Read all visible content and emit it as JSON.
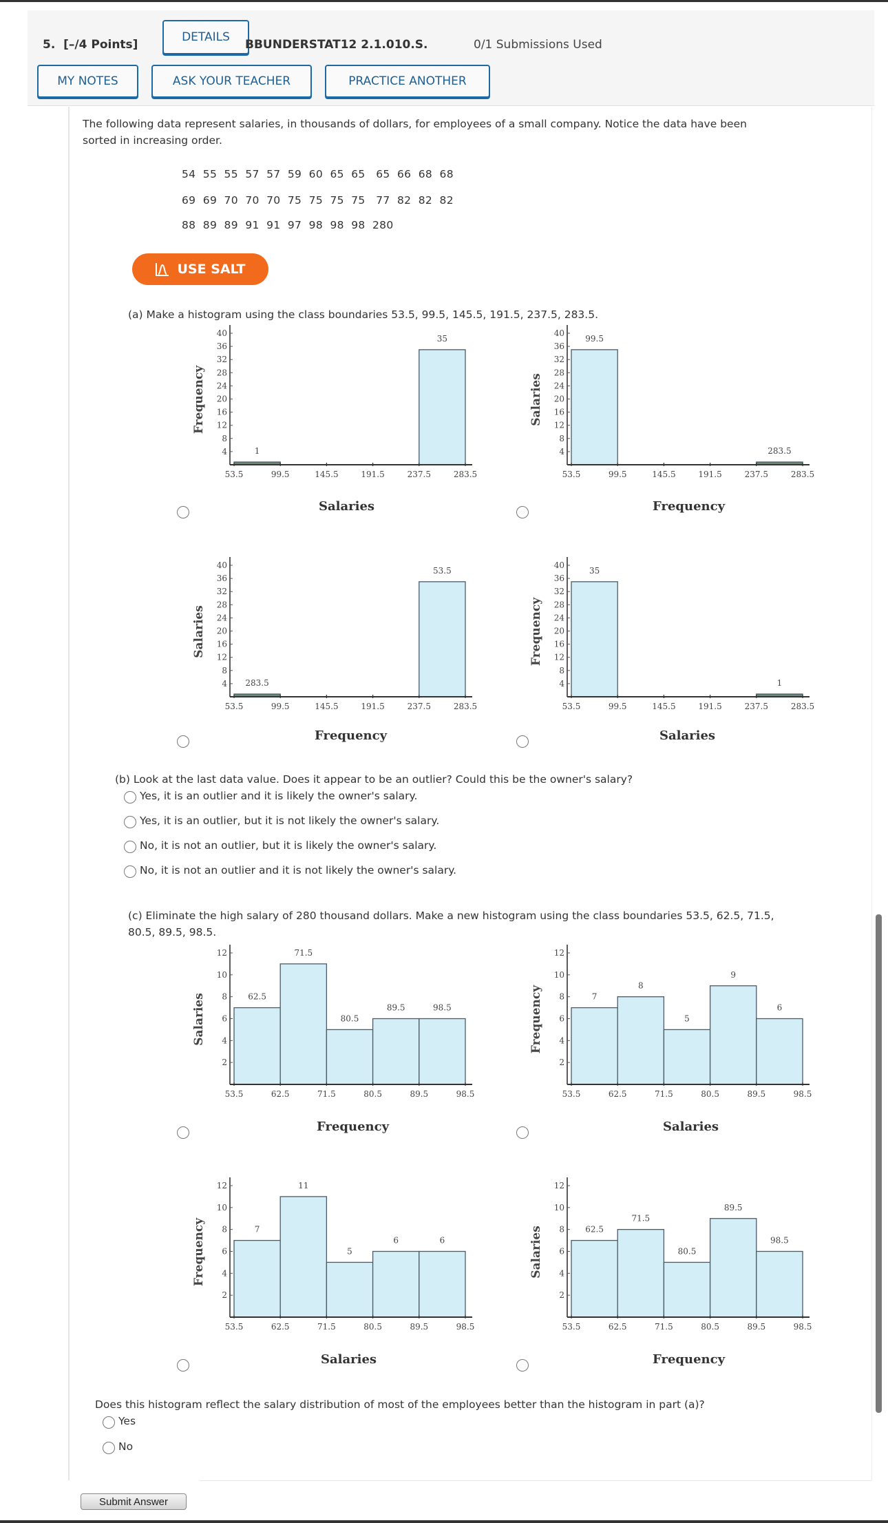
{
  "header": {
    "question_number": "5.",
    "points": "[–/4 Points]",
    "details_label": "DETAILS",
    "question_code": "BBUNDERSTAT12 2.1.010.S.",
    "submissions": "0/1 Submissions Used",
    "my_notes_label": "MY NOTES",
    "ask_teacher_label": "ASK YOUR TEACHER",
    "practice_another_label": "PRACTICE ANOTHER"
  },
  "intro": {
    "line1": "The following data represent salaries, in thousands of dollars, for employees of a small company. Notice the data have been",
    "line2": "sorted in increasing order.",
    "data_rows": [
      "54  55  55  57  57  59  60  65  65   65  66  68  68",
      "69  69  70  70  70  75  75  75  75   77  82  82  82",
      "88  89  89  91  91  97  98  98  98  280"
    ]
  },
  "salt": {
    "label": "USE SALT",
    "icon": "salt-distribution-icon"
  },
  "part_a": {
    "prompt": "(a) Make a histogram using the class boundaries 53.5, 99.5, 145.5, 191.5, 237.5, 283.5."
  },
  "part_b": {
    "prompt": "(b) Look at the last data value. Does it appear to be an outlier? Could this be the owner's salary?",
    "options": [
      "Yes, it is an outlier and it is likely the owner's salary.",
      "Yes, it is an outlier, but it is not likely the owner's salary.",
      "No, it is not an outlier, but it is likely the owner's salary.",
      "No, it is not an outlier and it is not likely the owner's salary."
    ]
  },
  "part_c": {
    "prompt_line1": "(c) Eliminate the high salary of 280 thousand dollars. Make a new histogram using the class boundaries 53.5, 62.5, 71.5,",
    "prompt_line2": "80.5, 89.5, 98.5.",
    "followup": "Does this histogram reflect the salary distribution of most of the employees better than the histogram in part (a)?",
    "followup_options": [
      "Yes",
      "No"
    ]
  },
  "submit_label": "Submit Answer",
  "colors": {
    "accent_blue": "#1c6aa5",
    "salt_orange": "#f26b1d",
    "bar_fill": "#d4eef8",
    "bar_stroke": "#4a5a68",
    "small_bar_fill": "#6f8a78"
  },
  "chart_data": [
    {
      "id": "a1",
      "type": "bar",
      "categories": [
        "53.5",
        "99.5",
        "145.5",
        "191.5",
        "237.5",
        "283.5"
      ],
      "bins": [
        [
          53.5,
          99.5
        ],
        [
          99.5,
          145.5
        ],
        [
          145.5,
          191.5
        ],
        [
          191.5,
          237.5
        ],
        [
          237.5,
          283.5
        ]
      ],
      "values": [
        1,
        0,
        0,
        0,
        35
      ],
      "bar_labels": [
        "1",
        "",
        "",
        "",
        "35"
      ],
      "xlabel": "Salaries",
      "ylabel": "Frequency",
      "yticks": [
        4,
        8,
        12,
        16,
        20,
        24,
        28,
        32,
        36,
        40
      ],
      "ylim": [
        0,
        40
      ],
      "grid": false
    },
    {
      "id": "a2",
      "type": "bar",
      "categories": [
        "53.5",
        "99.5",
        "145.5",
        "191.5",
        "237.5",
        "283.5"
      ],
      "bins": [
        [
          53.5,
          99.5
        ],
        [
          99.5,
          145.5
        ],
        [
          145.5,
          191.5
        ],
        [
          191.5,
          237.5
        ],
        [
          237.5,
          283.5
        ]
      ],
      "values": [
        35,
        0,
        0,
        0,
        1
      ],
      "bar_labels": [
        "99.5",
        "",
        "",
        "",
        "283.5"
      ],
      "xlabel": "Frequency",
      "ylabel": "Salaries",
      "yticks": [
        4,
        8,
        12,
        16,
        20,
        24,
        28,
        32,
        36,
        40
      ],
      "ylim": [
        0,
        40
      ],
      "grid": false
    },
    {
      "id": "a3",
      "type": "bar",
      "categories": [
        "53.5",
        "99.5",
        "145.5",
        "191.5",
        "237.5",
        "283.5"
      ],
      "bins": [
        [
          53.5,
          99.5
        ],
        [
          99.5,
          145.5
        ],
        [
          145.5,
          191.5
        ],
        [
          191.5,
          237.5
        ],
        [
          237.5,
          283.5
        ]
      ],
      "values": [
        1,
        0,
        0,
        0,
        35
      ],
      "bar_labels": [
        "283.5",
        "",
        "",
        "",
        "53.5"
      ],
      "xlabel": "Frequency",
      "ylabel": "Salaries",
      "yticks": [
        4,
        8,
        12,
        16,
        20,
        24,
        28,
        32,
        36,
        40
      ],
      "ylim": [
        0,
        40
      ],
      "grid": false
    },
    {
      "id": "a4",
      "type": "bar",
      "categories": [
        "53.5",
        "99.5",
        "145.5",
        "191.5",
        "237.5",
        "283.5"
      ],
      "bins": [
        [
          53.5,
          99.5
        ],
        [
          99.5,
          145.5
        ],
        [
          145.5,
          191.5
        ],
        [
          191.5,
          237.5
        ],
        [
          237.5,
          283.5
        ]
      ],
      "values": [
        35,
        0,
        0,
        0,
        1
      ],
      "bar_labels": [
        "35",
        "",
        "",
        "",
        "1"
      ],
      "xlabel": "Salaries",
      "ylabel": "Frequency",
      "yticks": [
        4,
        8,
        12,
        16,
        20,
        24,
        28,
        32,
        36,
        40
      ],
      "ylim": [
        0,
        40
      ],
      "grid": false
    },
    {
      "id": "c1",
      "type": "bar",
      "categories": [
        "53.5",
        "62.5",
        "71.5",
        "80.5",
        "89.5",
        "98.5"
      ],
      "bins": [
        [
          53.5,
          62.5
        ],
        [
          62.5,
          71.5
        ],
        [
          71.5,
          80.5
        ],
        [
          80.5,
          89.5
        ],
        [
          89.5,
          98.5
        ]
      ],
      "values": [
        7,
        11,
        5,
        6,
        6
      ],
      "bar_labels": [
        "62.5",
        "71.5",
        "80.5",
        "89.5",
        "98.5"
      ],
      "xlabel": "Frequency",
      "ylabel": "Salaries",
      "yticks": [
        2,
        4,
        6,
        8,
        10,
        12
      ],
      "ylim": [
        0,
        12
      ],
      "grid": false
    },
    {
      "id": "c2",
      "type": "bar",
      "categories": [
        "53.5",
        "62.5",
        "71.5",
        "80.5",
        "89.5",
        "98.5"
      ],
      "bins": [
        [
          53.5,
          62.5
        ],
        [
          62.5,
          71.5
        ],
        [
          71.5,
          80.5
        ],
        [
          80.5,
          89.5
        ],
        [
          89.5,
          98.5
        ]
      ],
      "values": [
        7,
        8,
        5,
        9,
        6
      ],
      "bar_labels": [
        "7",
        "8",
        "5",
        "9",
        "6"
      ],
      "xlabel": "Salaries",
      "ylabel": "Frequency",
      "yticks": [
        2,
        4,
        6,
        8,
        10,
        12
      ],
      "ylim": [
        0,
        12
      ],
      "grid": false
    },
    {
      "id": "c3",
      "type": "bar",
      "categories": [
        "53.5",
        "62.5",
        "71.5",
        "80.5",
        "89.5",
        "98.5"
      ],
      "bins": [
        [
          53.5,
          62.5
        ],
        [
          62.5,
          71.5
        ],
        [
          71.5,
          80.5
        ],
        [
          80.5,
          89.5
        ],
        [
          89.5,
          98.5
        ]
      ],
      "values": [
        7,
        11,
        5,
        6,
        6
      ],
      "bar_labels": [
        "7",
        "11",
        "5",
        "6",
        "6"
      ],
      "xlabel": "Salaries",
      "ylabel": "Frequency",
      "yticks": [
        2,
        4,
        6,
        8,
        10,
        12
      ],
      "ylim": [
        0,
        12
      ],
      "grid": false
    },
    {
      "id": "c4",
      "type": "bar",
      "categories": [
        "53.5",
        "62.5",
        "71.5",
        "80.5",
        "89.5",
        "98.5"
      ],
      "bins": [
        [
          53.5,
          62.5
        ],
        [
          62.5,
          71.5
        ],
        [
          71.5,
          80.5
        ],
        [
          80.5,
          89.5
        ],
        [
          89.5,
          98.5
        ]
      ],
      "values": [
        7,
        8,
        5,
        9,
        6
      ],
      "bar_labels": [
        "62.5",
        "71.5",
        "80.5",
        "89.5",
        "98.5"
      ],
      "xlabel": "Frequency",
      "ylabel": "Salaries",
      "yticks": [
        2,
        4,
        6,
        8,
        10,
        12
      ],
      "ylim": [
        0,
        12
      ],
      "grid": false
    }
  ]
}
